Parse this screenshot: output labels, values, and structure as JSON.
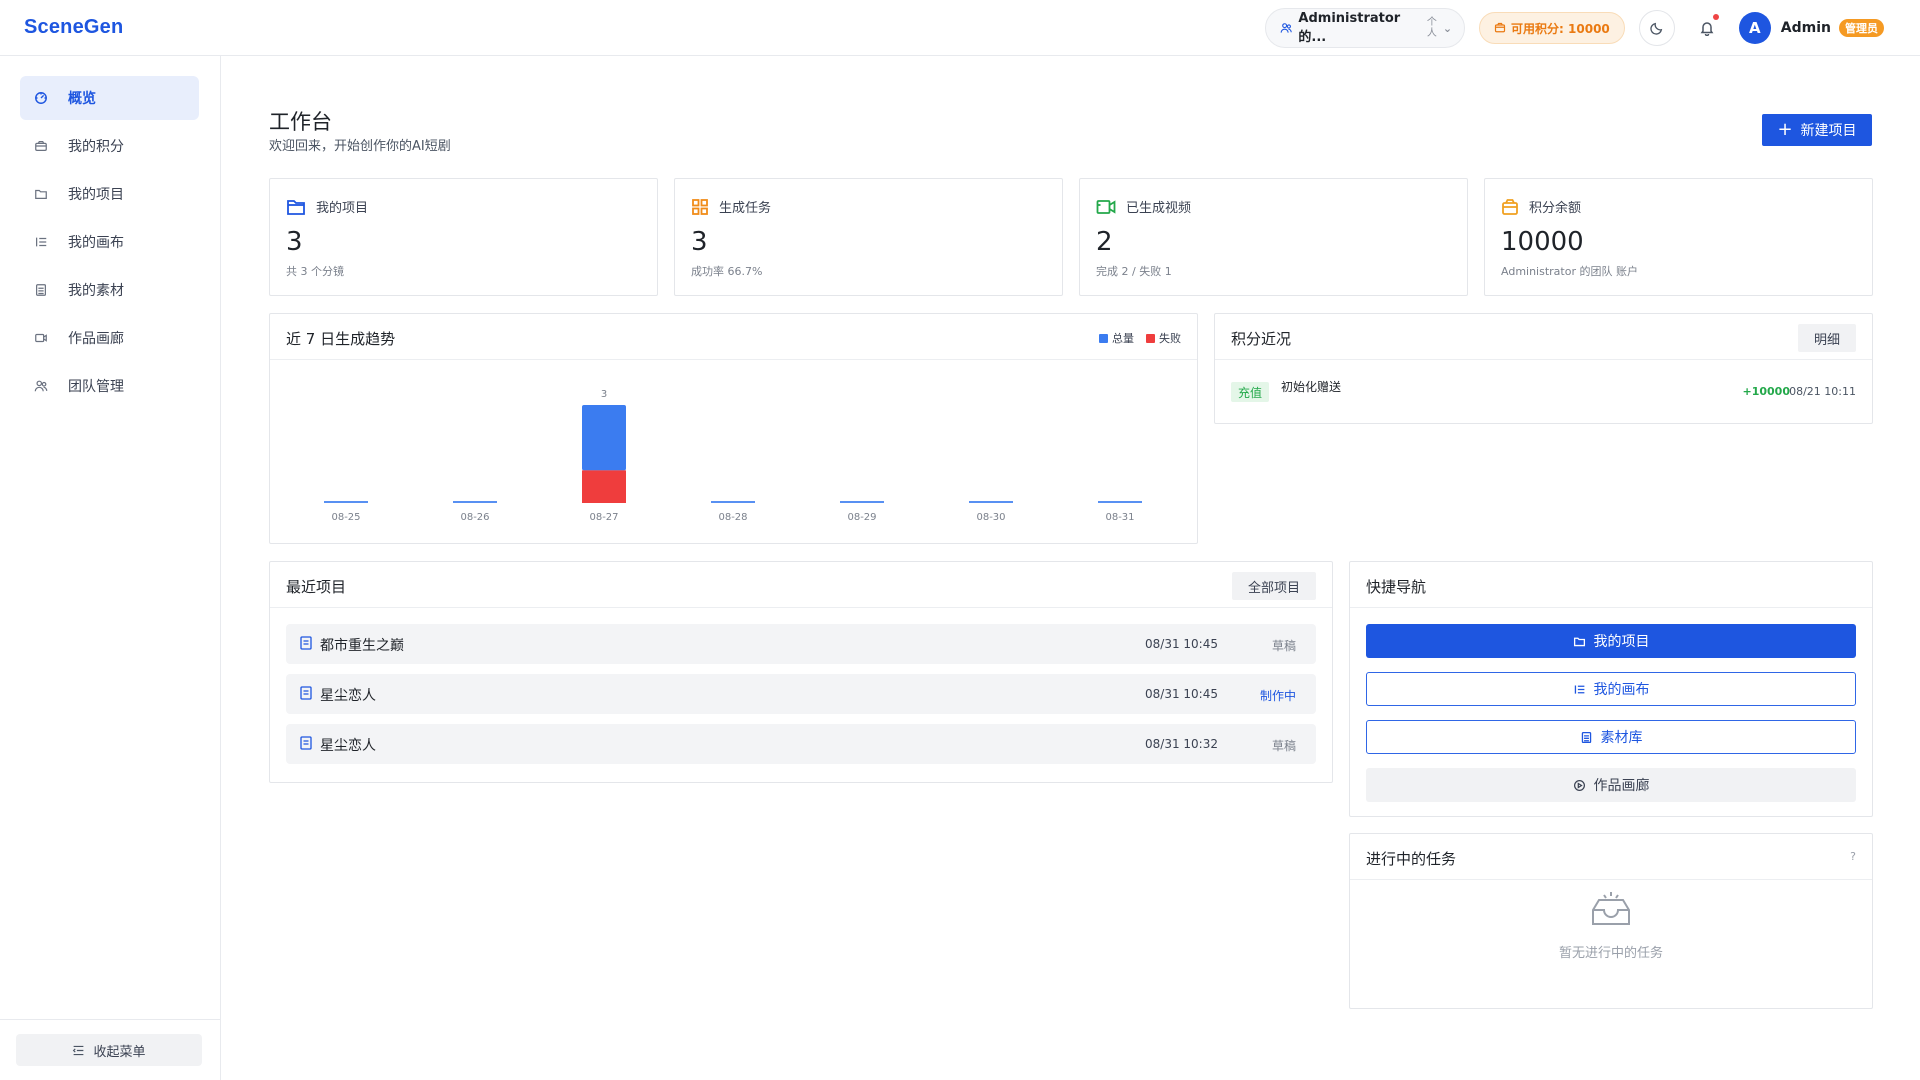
{
  "app": {
    "logo": "SceneGen"
  },
  "header": {
    "team": "Administrator 的...",
    "team_arrow_up": "个",
    "team_arrow_down": "人",
    "points": "可用积分: 10000",
    "avatar_letter": "A",
    "user_name": "Admin",
    "role": "管理员"
  },
  "sidebar": {
    "items": [
      {
        "label": "概览",
        "icon": "dashboard-icon",
        "active": true
      },
      {
        "label": "我的积分",
        "icon": "wallet-icon"
      },
      {
        "label": "我的项目",
        "icon": "folder-icon"
      },
      {
        "label": "我的画布",
        "icon": "list-icon"
      },
      {
        "label": "我的素材",
        "icon": "material-icon"
      },
      {
        "label": "作品画廊",
        "icon": "video-icon"
      },
      {
        "label": "团队管理",
        "icon": "team-icon"
      }
    ],
    "collapse_label": "收起菜单"
  },
  "page": {
    "title": "工作台",
    "subtitle": "欢迎回来，开始创作你的AI短剧",
    "new_button": "新建项目"
  },
  "stats": [
    {
      "label": "我的项目",
      "value": "3",
      "sub": "共 3 个分镜",
      "color": "#1e56e0"
    },
    {
      "label": "生成任务",
      "value": "3",
      "sub": "成功率 66.7%",
      "color": "#f08c1a"
    },
    {
      "label": "已生成视频",
      "value": "2",
      "sub": "完成 2 / 失败 1",
      "color": "#23a84a"
    },
    {
      "label": "积分余额",
      "value": "10000",
      "sub": "Administrator 的团队 账户",
      "color": "#f0a020"
    }
  ],
  "trend": {
    "title": "近 7 日生成趋势",
    "legend": [
      {
        "name": "总量",
        "color": "#3b7cf0"
      },
      {
        "name": "失败",
        "color": "#ef3d3d"
      }
    ]
  },
  "chart_data": {
    "type": "bar",
    "title": "近 7 日生成趋势",
    "categories": [
      "08-25",
      "08-26",
      "08-27",
      "08-28",
      "08-29",
      "08-30",
      "08-31"
    ],
    "series": [
      {
        "name": "总量",
        "values": [
          0,
          0,
          3,
          0,
          0,
          0,
          0
        ]
      },
      {
        "name": "失败",
        "values": [
          0,
          0,
          1,
          0,
          0,
          0,
          0
        ]
      }
    ],
    "data_labels": [
      "",
      "",
      "3",
      "",
      "",
      "",
      ""
    ],
    "ylim": [
      0,
      3
    ],
    "grid": false,
    "legend": "top-right"
  },
  "points_panel": {
    "title": "积分近况",
    "detail_button": "明细",
    "rows": [
      {
        "tag": "充值",
        "desc": "初始化赠送",
        "amount": "+10000",
        "time": "08/21 10:11"
      }
    ]
  },
  "recent": {
    "title": "最近项目",
    "all_button": "全部项目",
    "rows": [
      {
        "name": "都市重生之巅",
        "time": "08/31 10:45",
        "status": "草稿",
        "active": false
      },
      {
        "name": "星尘恋人",
        "time": "08/31 10:45",
        "status": "制作中",
        "active": true
      },
      {
        "name": "星尘恋人",
        "time": "08/31 10:32",
        "status": "草稿",
        "active": false
      }
    ]
  },
  "quick": {
    "title": "快捷导航",
    "buttons": [
      {
        "label": "我的项目",
        "style": "primary",
        "icon": "folder-icon"
      },
      {
        "label": "我的画布",
        "style": "outline",
        "icon": "list-icon"
      },
      {
        "label": "素材库",
        "style": "outline",
        "icon": "material-icon"
      },
      {
        "label": "作品画廊",
        "style": "grey",
        "icon": "play-circle-icon"
      }
    ]
  },
  "tasks": {
    "title": "进行中的任务",
    "help": "?",
    "empty": "暂无进行中的任务"
  }
}
